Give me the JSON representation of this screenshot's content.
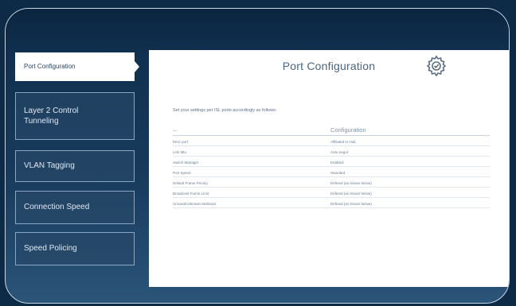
{
  "sidebar": {
    "items": [
      {
        "label": "Port Configuration"
      },
      {
        "label": "Layer 2 Control Tunneling"
      },
      {
        "label": "VLAN Tagging"
      },
      {
        "label": "Connection Speed"
      },
      {
        "label": "Speed Policing"
      }
    ]
  },
  "panel": {
    "title": "Port Configuration",
    "description": "Set your settings per ISL ports accordingly as follows:",
    "table": {
      "headers": [
        "—",
        "Configuration"
      ],
      "rows": [
        [
          "MAC port",
          "Affiliated to Hub"
        ],
        [
          "Link Mtu",
          "Auto-negot"
        ],
        [
          "Switch Manager",
          "Enabled"
        ],
        [
          "Port Speed",
          "Standard"
        ],
        [
          "Default Frame Priority",
          "Defined (as shown below)"
        ],
        [
          "Broadcast Frame Limit",
          "Defined (as shown below)"
        ],
        [
          "Unicast/Unknown Multicast",
          "Defined (as shown below)"
        ]
      ]
    }
  },
  "colors": {
    "background": "#0d2a47",
    "frame_border": "#c9d6e3",
    "panel": "#ffffff",
    "accent_text": "#4a6682"
  },
  "icons": {
    "panel_icon": "gear-icon"
  }
}
